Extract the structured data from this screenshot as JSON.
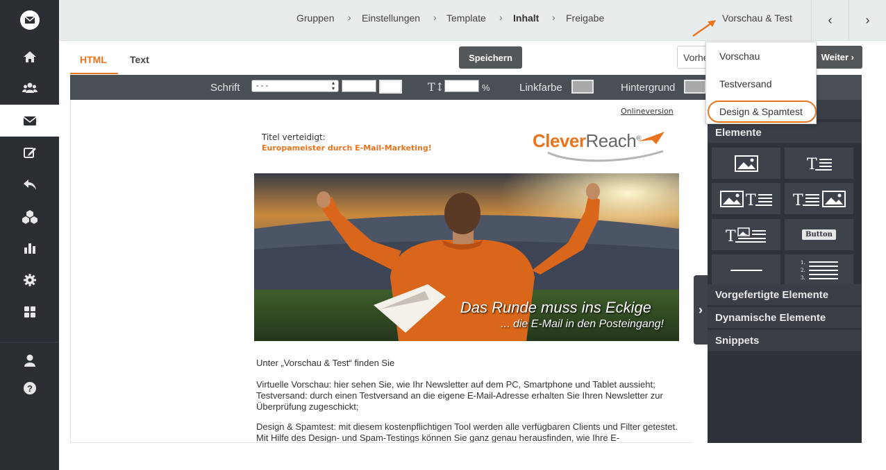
{
  "breadcrumb": {
    "steps": [
      "Gruppen",
      "Einstellungen",
      "Template",
      "Inhalt",
      "Freigabe"
    ],
    "active_step": "Inhalt",
    "preview_test": "Vorschau & Test",
    "separator": "›",
    "prev_icon": "chevron-left-icon",
    "next_icon": "chevron-right-icon",
    "prev_glyph": "‹",
    "next_glyph": "›"
  },
  "sidebar": {
    "items": [
      {
        "icon": "mail-logo-icon"
      },
      {
        "icon": "home-icon"
      },
      {
        "icon": "users-icon"
      },
      {
        "icon": "envelope-icon",
        "active": true
      },
      {
        "icon": "edit-icon"
      },
      {
        "icon": "reply-icon"
      },
      {
        "icon": "cubes-icon"
      },
      {
        "icon": "bar-chart-icon"
      },
      {
        "icon": "gear-icon"
      },
      {
        "icon": "grid-icon"
      },
      {
        "icon": "user-icon"
      },
      {
        "icon": "help-icon"
      }
    ]
  },
  "tabs": {
    "html": "HTML",
    "text": "Text"
  },
  "toolbar": {
    "save_label": "Speichern",
    "preview_select": "Vorhe",
    "weiter_label": "Weiter ›"
  },
  "format_bar": {
    "font_label": "Schrift",
    "font_value": "- - -",
    "size_icon": "text-size-icon",
    "size_glyph": "T↕",
    "percent": "%",
    "linkcolor_label": "Linkfarbe",
    "background_label": "Hintergrund"
  },
  "email": {
    "online_version": "Onlineversion",
    "header_title": "Titel verteidigt:",
    "header_subtitle": "Europameister durch E-Mail-Marketing!",
    "logo_clever": "Clever",
    "logo_reach": "Reach",
    "logo_mark": "®",
    "hero_caption_1": "Das Runde muss ins Eckige",
    "hero_caption_2": "... die E-Mail in den Posteingang!",
    "para_1": "Unter „Vorschau & Test“ finden Sie",
    "para_2": "Virtuelle Vorschau: hier sehen Sie, wie Ihr Newsletter auf dem PC, Smartphone und Tablet aussieht; Testversand: durch einen Testversand an die eigene E-Mail-Adresse erhalten Sie Ihren Newsletter zur Überprüfung zugeschickt;",
    "para_3": "Design & Spamtest: mit diesem kostenpflichtigen Tool werden alle verfügbaren Clients und Filter getestet. Mit Hilfe des Design- und Spam-Testings können Sie ganz genau herausfinden, wie Ihre E-"
  },
  "right_panel": {
    "elements_heading": "Elemente",
    "tiles": [
      "image-block",
      "text-block",
      "image-text-block",
      "text-image-block",
      "text-with-image-block",
      "button-block",
      "divider-block",
      "list-block"
    ],
    "button_tile_label": "Button",
    "list_numbers": [
      "1.",
      "2.",
      "3."
    ],
    "prebuilt_heading": "Vorgefertigte Elemente",
    "dynamic_heading": "Dynamische Elemente",
    "snippets_heading": "Snippets",
    "toggle_glyph": "›"
  },
  "dropdown": {
    "items": [
      "Vorschau",
      "Testversand",
      "Design & Spamtest"
    ],
    "highlighted": "Design & Spamtest"
  },
  "colors": {
    "accent": "#e8741e",
    "sidebar": "#2b2e33",
    "panel": "#2e3239",
    "toolbar": "#4a4f56"
  }
}
